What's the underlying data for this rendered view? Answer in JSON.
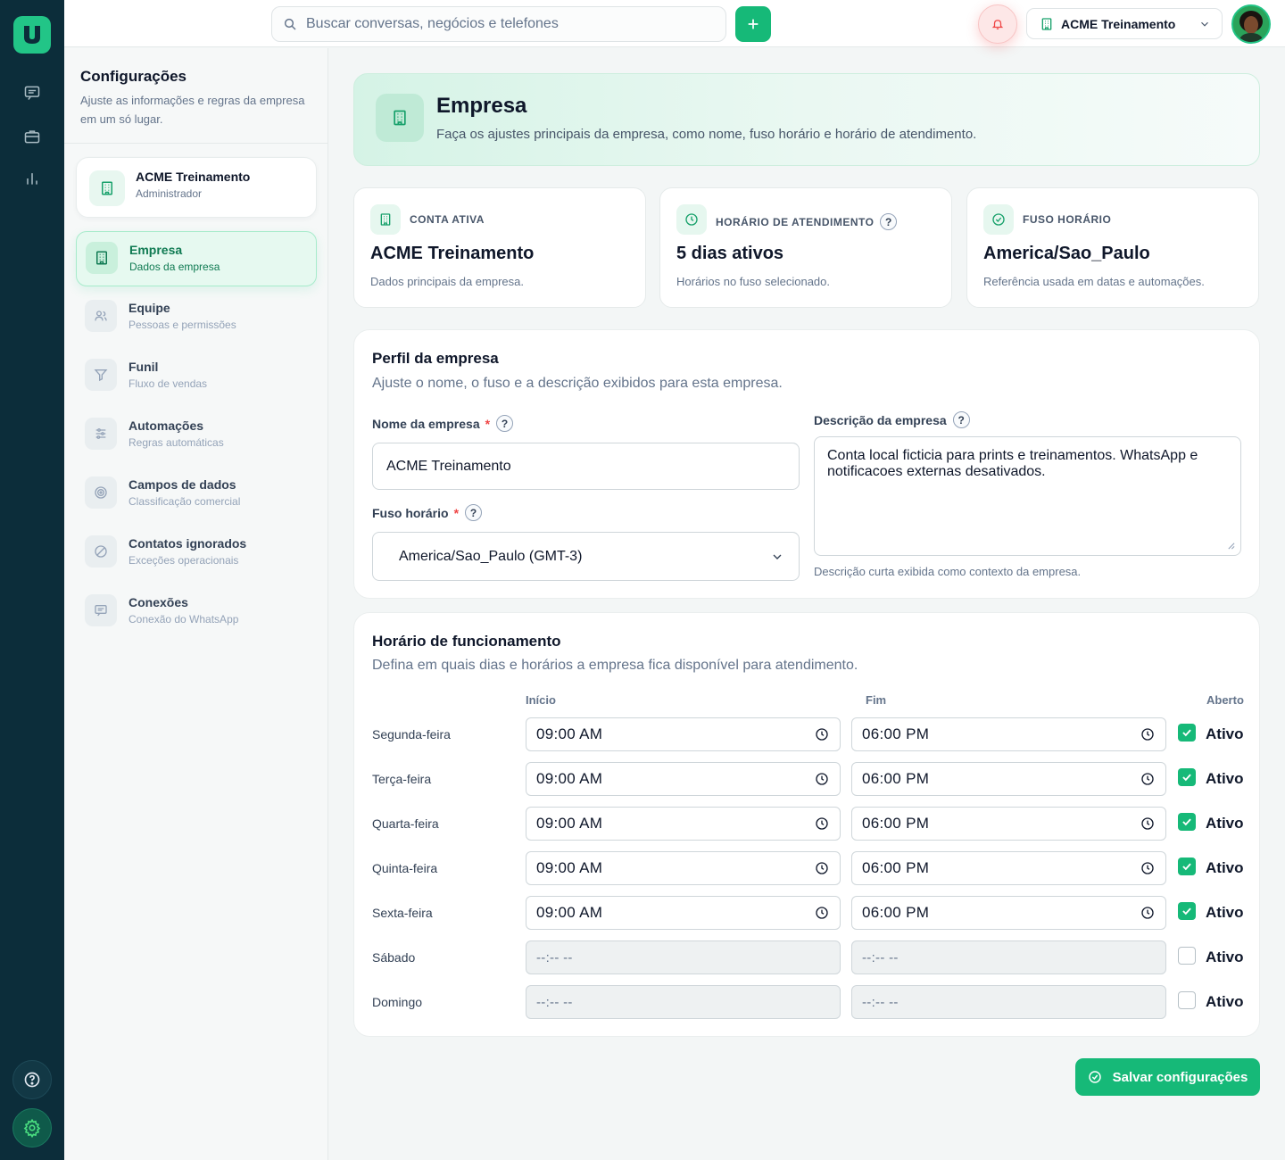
{
  "colors": {
    "accent": "#16b978",
    "rail": "#0c2d3a",
    "required": "#ef4444"
  },
  "topbar": {
    "search_placeholder": "Buscar conversas, negócios e telefones",
    "company_selector": "ACME Treinamento",
    "icons": [
      "search-icon",
      "plus-icon",
      "bell-icon",
      "building-icon",
      "chevron-down-icon"
    ]
  },
  "rail": {
    "icons": [
      "logo-icon",
      "chat-icon",
      "briefcase-icon",
      "bar-chart-icon",
      "help-icon",
      "gear-icon"
    ]
  },
  "sidebar": {
    "title": "Configurações",
    "subtitle": "Ajuste as informações e regras da empresa em um só lugar.",
    "account": {
      "name": "ACME Treinamento",
      "role": "Administrador"
    },
    "items": [
      {
        "label": "Empresa",
        "desc": "Dados da empresa",
        "icon": "building-icon",
        "active": true
      },
      {
        "label": "Equipe",
        "desc": "Pessoas e permissões",
        "icon": "users-icon",
        "active": false
      },
      {
        "label": "Funil",
        "desc": "Fluxo de vendas",
        "icon": "filter-icon",
        "active": false
      },
      {
        "label": "Automações",
        "desc": "Regras automáticas",
        "icon": "sliders-icon",
        "active": false
      },
      {
        "label": "Campos de dados",
        "desc": "Classificação comercial",
        "icon": "target-icon",
        "active": false
      },
      {
        "label": "Contatos ignorados",
        "desc": "Exceções operacionais",
        "icon": "ban-icon",
        "active": false
      },
      {
        "label": "Conexões",
        "desc": "Conexão do WhatsApp",
        "icon": "message-icon",
        "active": false
      }
    ]
  },
  "hero": {
    "title": "Empresa",
    "subtitle": "Faça os ajustes principais da empresa, como nome, fuso horário e horário de atendimento."
  },
  "stats": [
    {
      "label": "CONTA ATIVA",
      "value": "ACME Treinamento",
      "desc": "Dados principais da empresa.",
      "icon": "building-icon"
    },
    {
      "label": "HORÁRIO DE ATENDIMENTO",
      "value": "5 dias ativos",
      "desc": "Horários no fuso selecionado.",
      "icon": "clock-icon",
      "help": "?"
    },
    {
      "label": "FUSO HORÁRIO",
      "value": "America/Sao_Paulo",
      "desc": "Referência usada em datas e automações.",
      "icon": "check-circle-icon"
    }
  ],
  "profile": {
    "title": "Perfil da empresa",
    "subtitle": "Ajuste o nome, o fuso e a descrição exibidos para esta empresa.",
    "name_label": "Nome da empresa",
    "name_value": "ACME Treinamento",
    "timezone_label": "Fuso horário",
    "timezone_value": "America/Sao_Paulo (GMT-3)",
    "description_label": "Descrição da empresa",
    "description_value": "Conta local ficticia para prints e treinamentos. WhatsApp e notificacoes externas desativados.",
    "description_help": "Descrição curta exibida como contexto da empresa.",
    "required_mark": "*",
    "help_mark": "?"
  },
  "schedule": {
    "title": "Horário de funcionamento",
    "subtitle": "Defina em quais dias e horários a empresa fica disponível para atendimento.",
    "col_start": "Início",
    "col_end": "Fim",
    "col_open": "Aberto",
    "active_label": "Ativo",
    "days": [
      {
        "day": "Segunda-feira",
        "start": "09:00 AM",
        "end": "06:00 PM",
        "open": true
      },
      {
        "day": "Terça-feira",
        "start": "09:00 AM",
        "end": "06:00 PM",
        "open": true
      },
      {
        "day": "Quarta-feira",
        "start": "09:00 AM",
        "end": "06:00 PM",
        "open": true
      },
      {
        "day": "Quinta-feira",
        "start": "09:00 AM",
        "end": "06:00 PM",
        "open": true
      },
      {
        "day": "Sexta-feira",
        "start": "09:00 AM",
        "end": "06:00 PM",
        "open": true
      },
      {
        "day": "Sábado",
        "start": "--:-- --",
        "end": "--:-- --",
        "open": false
      },
      {
        "day": "Domingo",
        "start": "--:-- --",
        "end": "--:-- --",
        "open": false
      }
    ]
  },
  "save_button": "Salvar configurações"
}
